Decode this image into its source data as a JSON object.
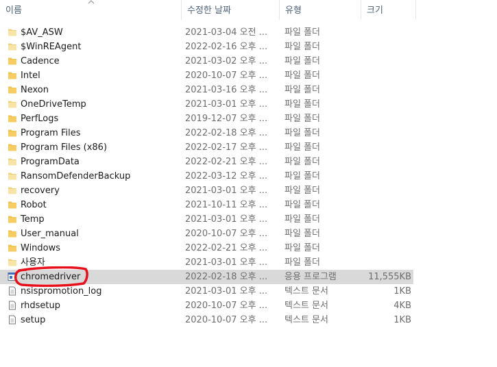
{
  "columns": [
    {
      "key": "name",
      "label": "이름"
    },
    {
      "key": "date",
      "label": "수정한 날짜"
    },
    {
      "key": "type",
      "label": "유형"
    },
    {
      "key": "size",
      "label": "크기"
    }
  ],
  "files": [
    {
      "name": "$AV_ASW",
      "date": "2021-03-04 오전 ...",
      "type": "파일 폴더",
      "size": "",
      "icon": "folder-light"
    },
    {
      "name": "$WinREAgent",
      "date": "2022-02-16 오후 ...",
      "type": "파일 폴더",
      "size": "",
      "icon": "folder-light"
    },
    {
      "name": "Cadence",
      "date": "2021-03-02 오후 ...",
      "type": "파일 폴더",
      "size": "",
      "icon": "folder"
    },
    {
      "name": "Intel",
      "date": "2020-10-07 오후 ...",
      "type": "파일 폴더",
      "size": "",
      "icon": "folder"
    },
    {
      "name": "Nexon",
      "date": "2021-03-16 오후 ...",
      "type": "파일 폴더",
      "size": "",
      "icon": "folder"
    },
    {
      "name": "OneDriveTemp",
      "date": "2021-03-01 오후 ...",
      "type": "파일 폴더",
      "size": "",
      "icon": "folder-light"
    },
    {
      "name": "PerfLogs",
      "date": "2019-12-07 오후 ...",
      "type": "파일 폴더",
      "size": "",
      "icon": "folder"
    },
    {
      "name": "Program Files",
      "date": "2022-02-18 오후 ...",
      "type": "파일 폴더",
      "size": "",
      "icon": "folder"
    },
    {
      "name": "Program Files (x86)",
      "date": "2022-02-17 오후 ...",
      "type": "파일 폴더",
      "size": "",
      "icon": "folder"
    },
    {
      "name": "ProgramData",
      "date": "2022-02-21 오후 ...",
      "type": "파일 폴더",
      "size": "",
      "icon": "folder-light"
    },
    {
      "name": "RansomDefenderBackup",
      "date": "2022-03-12 오후 ...",
      "type": "파일 폴더",
      "size": "",
      "icon": "folder-light"
    },
    {
      "name": "recovery",
      "date": "2021-03-01 오후 ...",
      "type": "파일 폴더",
      "size": "",
      "icon": "folder-light"
    },
    {
      "name": "Robot",
      "date": "2021-10-11 오후 ...",
      "type": "파일 폴더",
      "size": "",
      "icon": "folder"
    },
    {
      "name": "Temp",
      "date": "2021-03-01 오후 ...",
      "type": "파일 폴더",
      "size": "",
      "icon": "folder"
    },
    {
      "name": "User_manual",
      "date": "2020-10-07 오후 ...",
      "type": "파일 폴더",
      "size": "",
      "icon": "folder"
    },
    {
      "name": "Windows",
      "date": "2022-02-21 오후 ...",
      "type": "파일 폴더",
      "size": "",
      "icon": "folder"
    },
    {
      "name": "사용자",
      "date": "2021-03-01 오후 ...",
      "type": "파일 폴더",
      "size": "",
      "icon": "folder-light"
    },
    {
      "name": "chromedriver",
      "date": "2022-02-18 오후 ...",
      "type": "응용 프로그램",
      "size": "11,555KB",
      "icon": "application",
      "selected": true
    },
    {
      "name": "nsispromotion_log",
      "date": "2021-03-01 오후 ...",
      "type": "텍스트 문서",
      "size": "1KB",
      "icon": "text-document"
    },
    {
      "name": "rhdsetup",
      "date": "2020-10-07 오후 ...",
      "type": "텍스트 문서",
      "size": "4KB",
      "icon": "text-document"
    },
    {
      "name": "setup",
      "date": "2020-10-07 오후 ...",
      "type": "텍스트 문서",
      "size": "1KB",
      "icon": "text-document"
    }
  ],
  "colors": {
    "folder": "#f2c14e",
    "folder_light": "#f7dc92",
    "selected_row": "#d9d9d9",
    "annotation": "#e8101a",
    "header_text": "#4c607a"
  }
}
